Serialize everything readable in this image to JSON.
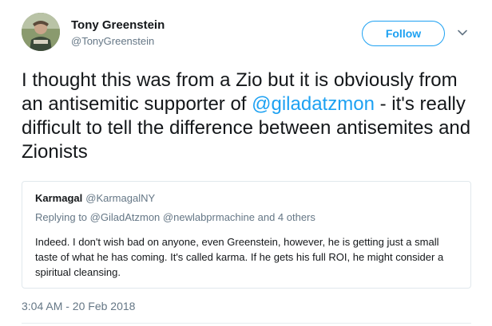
{
  "author": {
    "display_name": "Tony Greenstein",
    "handle": "@TonyGreenstein"
  },
  "follow_button": {
    "label": "Follow"
  },
  "menu": {
    "icon": "chevron-down-icon"
  },
  "tweet": {
    "text_part1": "I thought this was from a Zio but it is obviously from an antisemitic supporter of ",
    "mention": "@giladatzmon",
    "text_part2": " - it's really difficult to tell the difference between antisemites and Zionists"
  },
  "quoted_tweet": {
    "display_name": "Karmagal",
    "handle": "@KarmagalNY",
    "replying_prefix": "Replying to ",
    "replying_to_1": "@GiladAtzmon",
    "replying_to_2": "@newlabprmachine",
    "replying_suffix": " and 4 others",
    "body": "Indeed.  I don't wish bad on anyone, even Greenstein, however, he is getting just a small taste of what he has coming.  It's called karma.  If he gets his full ROI, he might consider a spiritual cleansing."
  },
  "timestamp": "3:04 AM - 20 Feb 2018",
  "colors": {
    "accent": "#1da1f2",
    "secondary_text": "#657786",
    "primary_text": "#14171a",
    "border": "#e1e8ed"
  }
}
